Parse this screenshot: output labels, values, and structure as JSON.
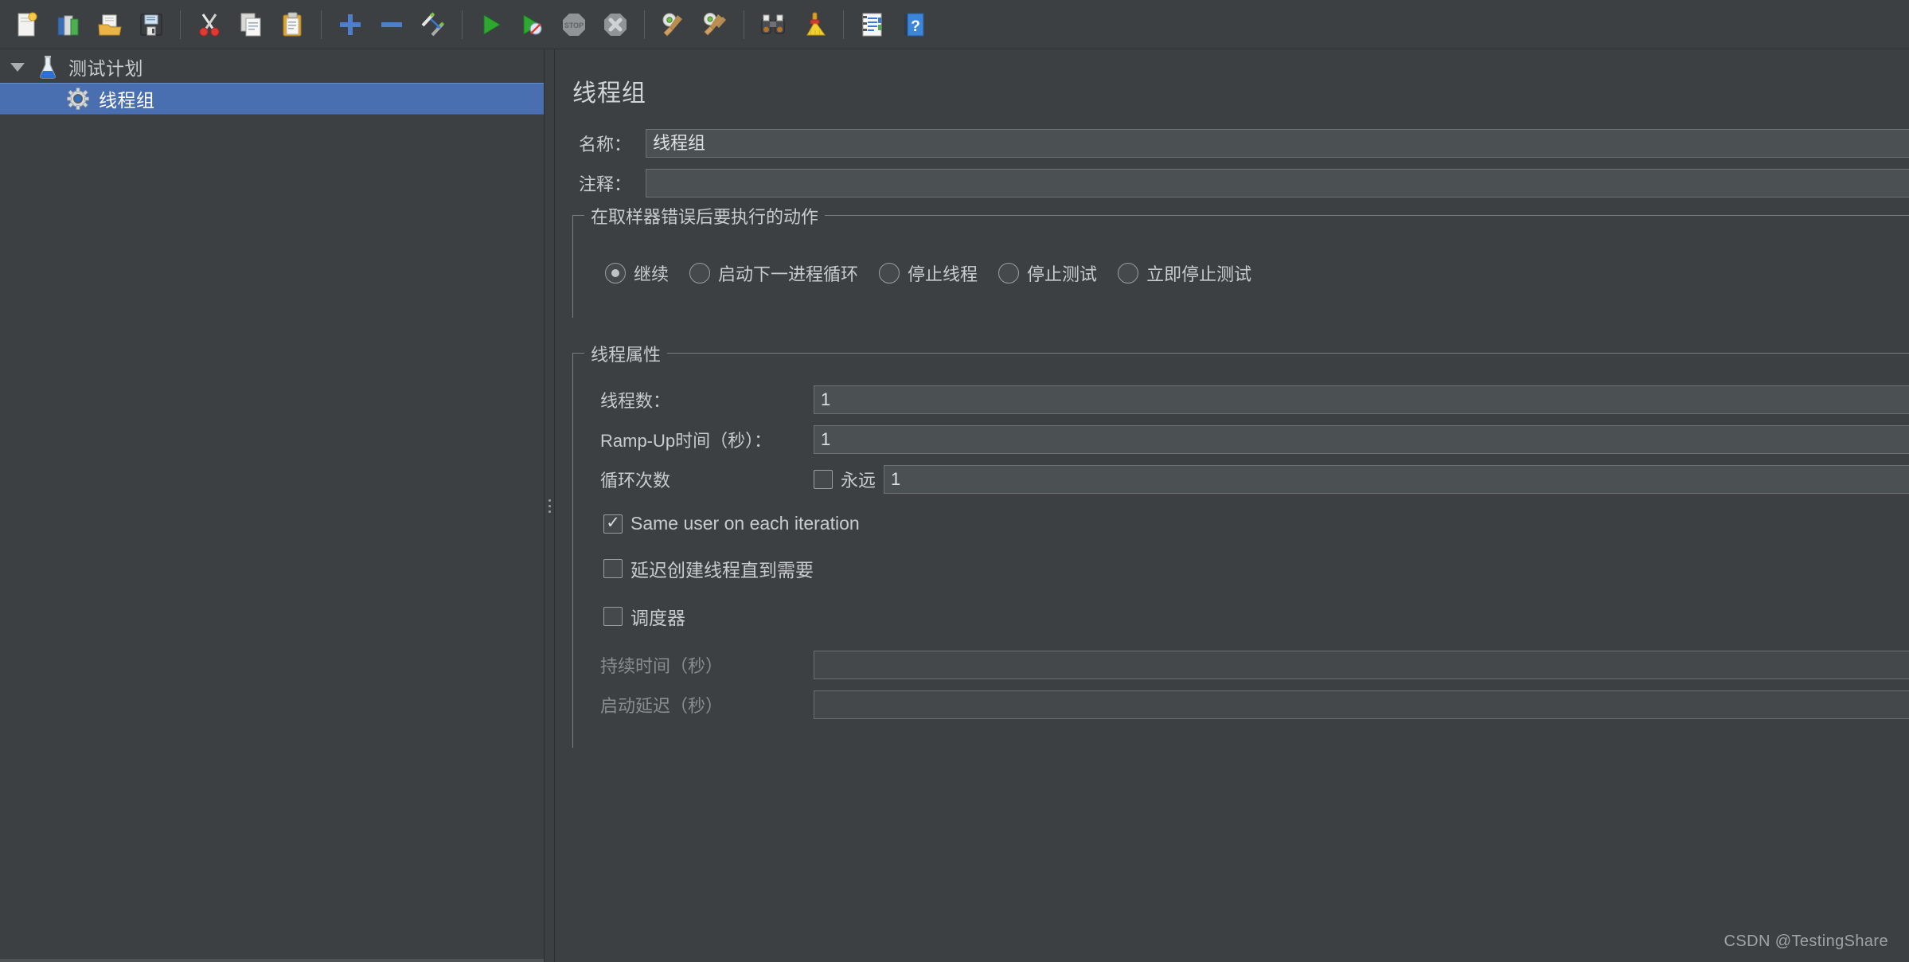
{
  "toolbar": {
    "buttons": [
      {
        "name": "new-file-button",
        "icon": "new-file-icon",
        "title": "新建"
      },
      {
        "name": "templates-button",
        "icon": "templates-icon",
        "title": "模板"
      },
      {
        "name": "open-button",
        "icon": "open-folder-icon",
        "title": "打开"
      },
      {
        "name": "save-button",
        "icon": "save-disk-icon",
        "title": "保存"
      },
      {
        "name": "cut-button",
        "icon": "scissors-icon",
        "title": "剪切"
      },
      {
        "name": "copy-button",
        "icon": "copy-icon",
        "title": "复制"
      },
      {
        "name": "paste-button",
        "icon": "clipboard-paste-icon",
        "title": "粘贴"
      },
      {
        "name": "expand-all-button",
        "icon": "plus-icon",
        "title": "展开全部"
      },
      {
        "name": "collapse-all-button",
        "icon": "minus-icon",
        "title": "折叠全部"
      },
      {
        "name": "toggle-button",
        "icon": "toggle-pencil-icon",
        "title": "启用/禁用"
      },
      {
        "name": "start-button",
        "icon": "play-green-icon",
        "title": "启动"
      },
      {
        "name": "start-no-timers-button",
        "icon": "play-no-timers-icon",
        "title": "无间隔启动"
      },
      {
        "name": "stop-button",
        "icon": "stop-sign-icon",
        "title": "停止"
      },
      {
        "name": "shutdown-button",
        "icon": "shutdown-x-icon",
        "title": "关闭"
      },
      {
        "name": "clear-button",
        "icon": "gear-broom-icon",
        "title": "清除"
      },
      {
        "name": "clear-all-button",
        "icon": "gear-broom-all-icon",
        "title": "清除全部"
      },
      {
        "name": "search-button",
        "icon": "binoculars-icon",
        "title": "查找"
      },
      {
        "name": "reset-search-button",
        "icon": "yellow-broom-icon",
        "title": "重置查找"
      },
      {
        "name": "function-helper-button",
        "icon": "notebook-icon",
        "title": "函数助手"
      },
      {
        "name": "help-button",
        "icon": "help-book-icon",
        "title": "帮助"
      }
    ]
  },
  "tree": {
    "root": {
      "label": "测试计划",
      "icon": "flask-icon",
      "expanded": true
    },
    "child": {
      "label": "线程组",
      "icon": "gear-thread-icon",
      "selected": true
    }
  },
  "panel": {
    "title": "线程组",
    "name_label": "名称：",
    "name_value": "线程组",
    "comment_label": "注释：",
    "comment_value": "",
    "on_error_group": {
      "title": "在取样器错误后要执行的动作",
      "options": [
        {
          "label": "继续",
          "selected": true
        },
        {
          "label": "启动下一进程循环",
          "selected": false
        },
        {
          "label": "停止线程",
          "selected": false
        },
        {
          "label": "停止测试",
          "selected": false
        },
        {
          "label": "立即停止测试",
          "selected": false
        }
      ]
    },
    "thread_props_group": {
      "title": "线程属性",
      "threads_label": "线程数：",
      "threads_value": "1",
      "rampup_label": "Ramp-Up时间（秒）：",
      "rampup_value": "1",
      "loops_label": "循环次数",
      "forever_label": "永远",
      "forever_checked": false,
      "loops_value": "1",
      "same_user_label": "Same user on each iteration",
      "same_user_checked": true,
      "delayed_start_label": "延迟创建线程直到需要",
      "delayed_start_checked": false,
      "scheduler_label": "调度器",
      "scheduler_checked": false,
      "duration_label": "持续时间（秒）",
      "duration_value": "",
      "duration_disabled": true,
      "startup_delay_label": "启动延迟（秒）",
      "startup_delay_value": "",
      "startup_delay_disabled": true
    }
  },
  "watermark": "CSDN @TestingShare",
  "colors": {
    "background": "#3c4043",
    "selection": "#4a6fb0",
    "text": "#c9ccce",
    "field_bg": "#4b5053",
    "border": "#6d7275"
  }
}
